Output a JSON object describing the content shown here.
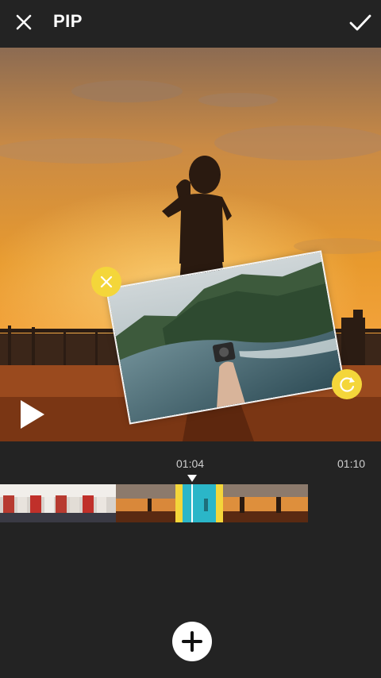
{
  "header": {
    "title": "PIP"
  },
  "timeline": {
    "current_time": "01:04",
    "end_time": "01:10"
  },
  "colors": {
    "background": "#232323",
    "accent_yellow": "#f4d63a",
    "selection_cyan": "#2bb6c8"
  },
  "icons": {
    "close": "close-icon",
    "confirm": "checkmark-icon",
    "play": "play-icon",
    "remove_pip": "close-icon",
    "rotate_pip": "rotate-icon",
    "add": "plus-icon"
  }
}
